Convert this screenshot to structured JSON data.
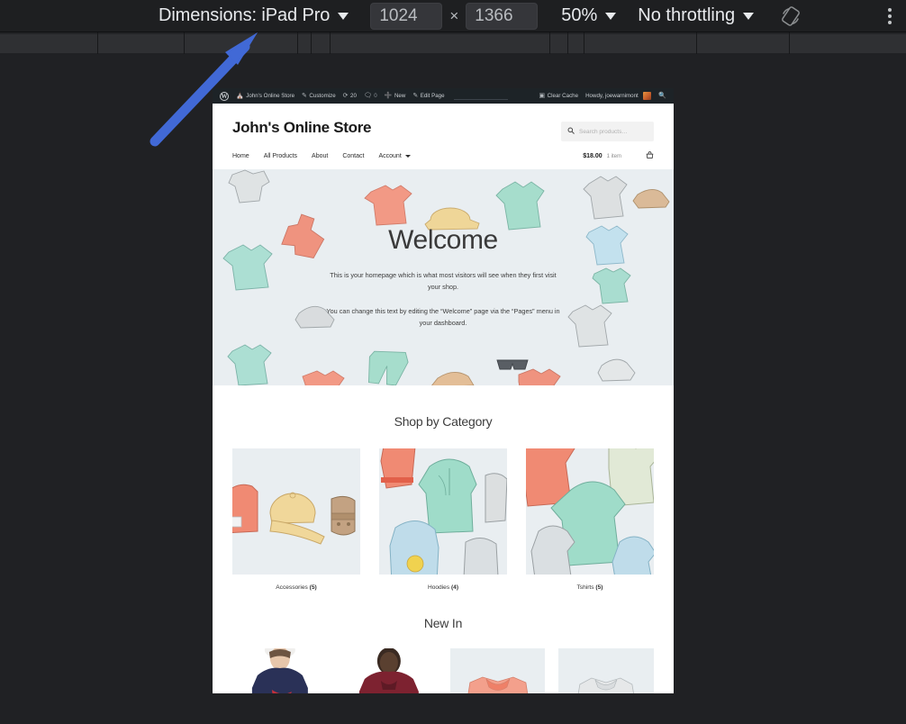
{
  "devtools_toolbar": {
    "dimensions_label": "Dimensions: iPad Pro",
    "dimensions_caret": "caret-down-icon",
    "width_value": "1024",
    "multiply_symbol": "×",
    "height_value": "1366",
    "zoom_label": "50%",
    "zoom_caret": "caret-down-icon",
    "throttling_label": "No throttling",
    "throttling_caret": "caret-down-icon",
    "rotate_icon": "rotate-device-icon",
    "more_options_icon": "kebab-menu-icon"
  },
  "annotation": {
    "arrow_color": "#4169d6",
    "arrow_name": "blue-pointer-arrow"
  },
  "wp_admin_bar": {
    "logo_icon": "wordpress-logo-icon",
    "site_icon": "dashboard-home-icon",
    "site_name": "John's Online Store",
    "customize_icon": "pencil-icon",
    "customize_label": "Customize",
    "updates_icon": "updates-refresh-icon",
    "updates_count": "20",
    "comments_icon": "comment-bubble-icon",
    "comments_count": "0",
    "new_icon": "plus-icon",
    "new_label": "New",
    "edit_icon": "pencil-edit-icon",
    "edit_label": "Edit Page",
    "cache_icon": "cache-box-icon",
    "cache_label": "Clear Cache",
    "howdy_label": "Howdy, joewarnimont",
    "avatar_name": "user-avatar",
    "search_icon": "search-icon"
  },
  "store": {
    "title": "John's Online Store",
    "search": {
      "icon": "search-icon",
      "placeholder": "Search products…"
    },
    "nav": [
      {
        "label": "Home"
      },
      {
        "label": "All Products"
      },
      {
        "label": "About"
      },
      {
        "label": "Contact"
      },
      {
        "label": "Account",
        "has_dropdown": true
      }
    ],
    "cart": {
      "price": "$18.00",
      "count": "1 item",
      "icon": "shopping-basket-icon"
    }
  },
  "hero": {
    "heading": "Welcome",
    "paragraph_1": "This is your homepage which is what most visitors will see when they first visit your shop.",
    "paragraph_2": "You can change this text by editing the “Welcome” page via the “Pages” menu in your dashboard.",
    "background_color": "#e9eef1"
  },
  "categories_section": {
    "title": "Shop by Category",
    "items": [
      {
        "name": "Accessories",
        "count": "(5)",
        "image": "watercolor-hats-belts"
      },
      {
        "name": "Hoodies",
        "count": "(4)",
        "image": "watercolor-hoodies"
      },
      {
        "name": "Tshirts",
        "count": "(5)",
        "image": "watercolor-tshirts"
      }
    ]
  },
  "new_in_section": {
    "title": "New In",
    "items": [
      {
        "image": "model-navy-tshirt"
      },
      {
        "image": "model-maroon-hoodie"
      },
      {
        "image": "folded-coral-tshirt"
      },
      {
        "image": "folded-grey-tshirt"
      }
    ]
  }
}
